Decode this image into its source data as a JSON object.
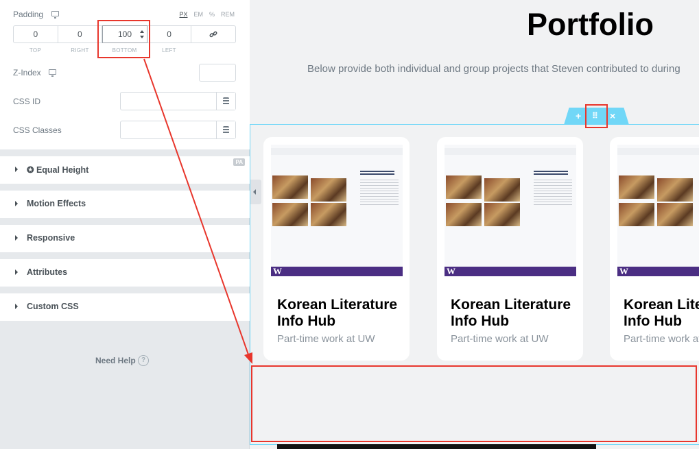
{
  "panel": {
    "padding": {
      "label": "Padding",
      "units": [
        "PX",
        "EM",
        "%",
        "REM"
      ],
      "values": {
        "top": "0",
        "right": "0",
        "bottom": "100",
        "left": "0"
      },
      "labels": {
        "top": "TOP",
        "right": "RIGHT",
        "bottom": "BOTTOM",
        "left": "LEFT"
      }
    },
    "z_index_label": "Z-Index",
    "css_id_label": "CSS ID",
    "css_classes_label": "CSS Classes",
    "accordion": [
      "✪ Equal Height",
      "Motion Effects",
      "Responsive",
      "Attributes",
      "Custom CSS"
    ],
    "pa_badge": "PA",
    "need_help": "Need Help",
    "help_icon_glyph": "?"
  },
  "preview": {
    "title": "Portfolio",
    "subtitle": "Below provide both individual and group projects that Steven contributed to during",
    "handle": {
      "add": "+",
      "move": "⠿",
      "close": "×"
    },
    "cards": [
      {
        "title": "Korean Literature Info Hub",
        "subtitle": "Part-time work at UW"
      },
      {
        "title": "Korean Literature Info Hub",
        "subtitle": "Part-time work at UW"
      },
      {
        "title": "Korean Literature Info Hub",
        "subtitle": "Part-time work at UW"
      }
    ],
    "shot_logo": "W"
  },
  "colors": {
    "accent": "#71d7f7",
    "annotation": "#e8362c",
    "uw_purple": "#4b2e83"
  }
}
